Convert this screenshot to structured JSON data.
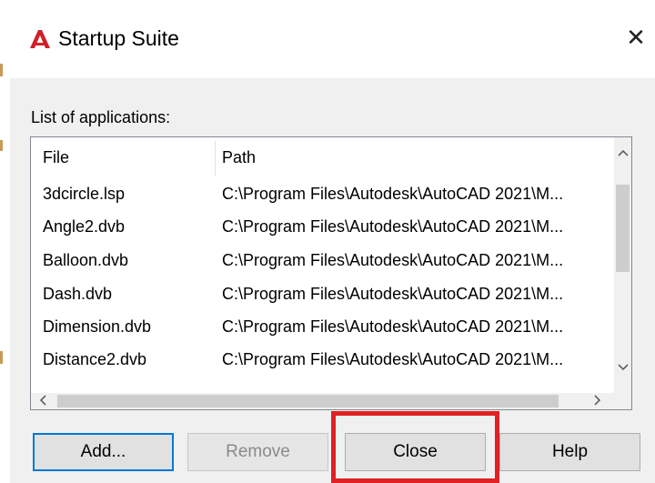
{
  "window": {
    "title": "Startup Suite",
    "close_glyph": "✕"
  },
  "section_label": "List of applications:",
  "columns": {
    "file": "File",
    "path": "Path"
  },
  "rows": [
    {
      "file": "3dcircle.lsp",
      "path": "C:\\Program Files\\Autodesk\\AutoCAD 2021\\M..."
    },
    {
      "file": "Angle2.dvb",
      "path": "C:\\Program Files\\Autodesk\\AutoCAD 2021\\M..."
    },
    {
      "file": "Balloon.dvb",
      "path": "C:\\Program Files\\Autodesk\\AutoCAD 2021\\M..."
    },
    {
      "file": "Dash.dvb",
      "path": "C:\\Program Files\\Autodesk\\AutoCAD 2021\\M..."
    },
    {
      "file": "Dimension.dvb",
      "path": "C:\\Program Files\\Autodesk\\AutoCAD 2021\\M..."
    },
    {
      "file": "Distance2.dvb",
      "path": "C:\\Program Files\\Autodesk\\AutoCAD 2021\\M..."
    }
  ],
  "buttons": {
    "add": "Add...",
    "remove": "Remove",
    "close": "Close",
    "help": "Help"
  },
  "colors": {
    "logo": "#d0202a",
    "highlight": "#e02022",
    "default_button_border": "#0078d7"
  },
  "icons": {
    "logo": "autocad-logo-icon",
    "close": "close-icon",
    "scroll_up": "chevron-up-icon",
    "scroll_down": "chevron-down-icon",
    "scroll_left": "chevron-left-icon",
    "scroll_right": "chevron-right-icon"
  }
}
